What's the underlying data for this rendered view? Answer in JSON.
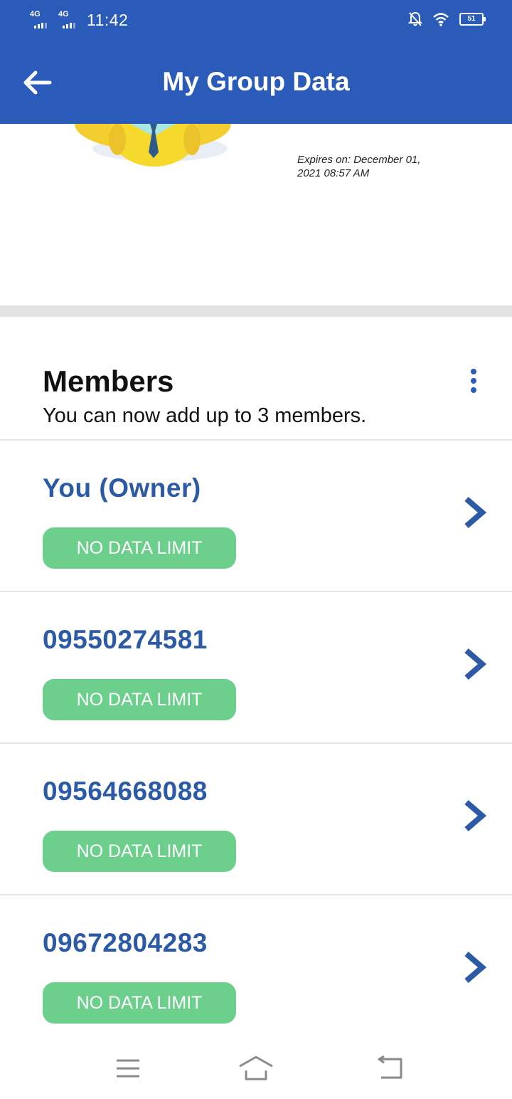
{
  "status_bar": {
    "signal_1_label": "4G",
    "signal_2_label": "4G",
    "time": "11:42",
    "battery_level": "51",
    "icons": [
      "mute-bell-icon",
      "wifi-icon",
      "battery-icon"
    ]
  },
  "app_bar": {
    "title": "My Group Data",
    "back_icon": "arrow-left-icon"
  },
  "plan": {
    "expires_line1": "Expires on: December 01,",
    "expires_line2": "2021 08:57 AM"
  },
  "members": {
    "title": "Members",
    "subtitle": "You can now add up to 3 members.",
    "items": [
      {
        "name": "You (Owner)",
        "badge": "NO DATA LIMIT"
      },
      {
        "name": "09550274581",
        "badge": "NO DATA LIMIT"
      },
      {
        "name": "09564668088",
        "badge": "NO DATA LIMIT"
      },
      {
        "name": "09672804283",
        "badge": "NO DATA LIMIT"
      }
    ]
  },
  "colors": {
    "brand_blue": "#2a5bb8",
    "member_name_blue": "#2c5aa6",
    "badge_green": "#6ccf8c"
  }
}
